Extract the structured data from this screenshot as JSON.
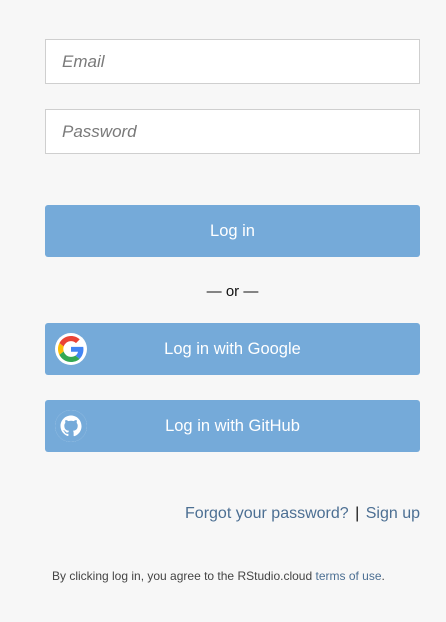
{
  "form": {
    "email_placeholder": "Email",
    "email_value": "",
    "password_placeholder": "Password",
    "password_value": "",
    "login_label": "Log in",
    "or_separator": "— or —"
  },
  "social": {
    "google_label": "Log in with Google",
    "google_icon": "google-g-icon",
    "github_label": "Log in with GitHub",
    "github_icon": "github-octocat-icon"
  },
  "links": {
    "forgot_password": "Forgot your password?",
    "separator": "|",
    "sign_up": "Sign up"
  },
  "terms": {
    "prefix": "By clicking log in, you agree to the RStudio.cloud ",
    "link": "terms of use",
    "suffix": "."
  },
  "colors": {
    "page_background": "#f7f7f7",
    "button_background": "#75aad9",
    "button_text": "#ffffff",
    "link": "#4c6f93",
    "input_border": "#cfcfcf"
  }
}
